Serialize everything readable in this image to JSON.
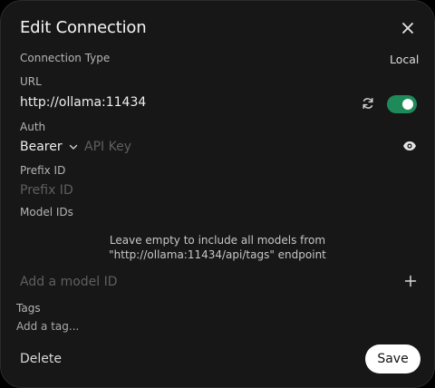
{
  "dialog": {
    "title": "Edit Connection"
  },
  "connection_type": {
    "label": "Connection Type",
    "value": "Local"
  },
  "url": {
    "label": "URL",
    "value": "http://ollama:11434",
    "enabled": true
  },
  "auth": {
    "label": "Auth",
    "type": "Bearer",
    "api_key_placeholder": "API Key"
  },
  "prefix": {
    "label": "Prefix ID",
    "placeholder": "Prefix ID"
  },
  "models": {
    "label": "Model IDs",
    "hint": "Leave empty to include all models from \"http://ollama:11434/api/tags\" endpoint",
    "placeholder": "Add a model ID"
  },
  "tags": {
    "label": "Tags",
    "placeholder": "Add a tag..."
  },
  "footer": {
    "delete_label": "Delete",
    "save_label": "Save"
  },
  "colors": {
    "modal_bg": "#171717",
    "toggle_on": "#1e8a5a",
    "save_bg": "#ffffff"
  },
  "icons": [
    "close-icon",
    "refresh-icon",
    "chevron-down-icon",
    "eye-icon",
    "plus-icon"
  ]
}
